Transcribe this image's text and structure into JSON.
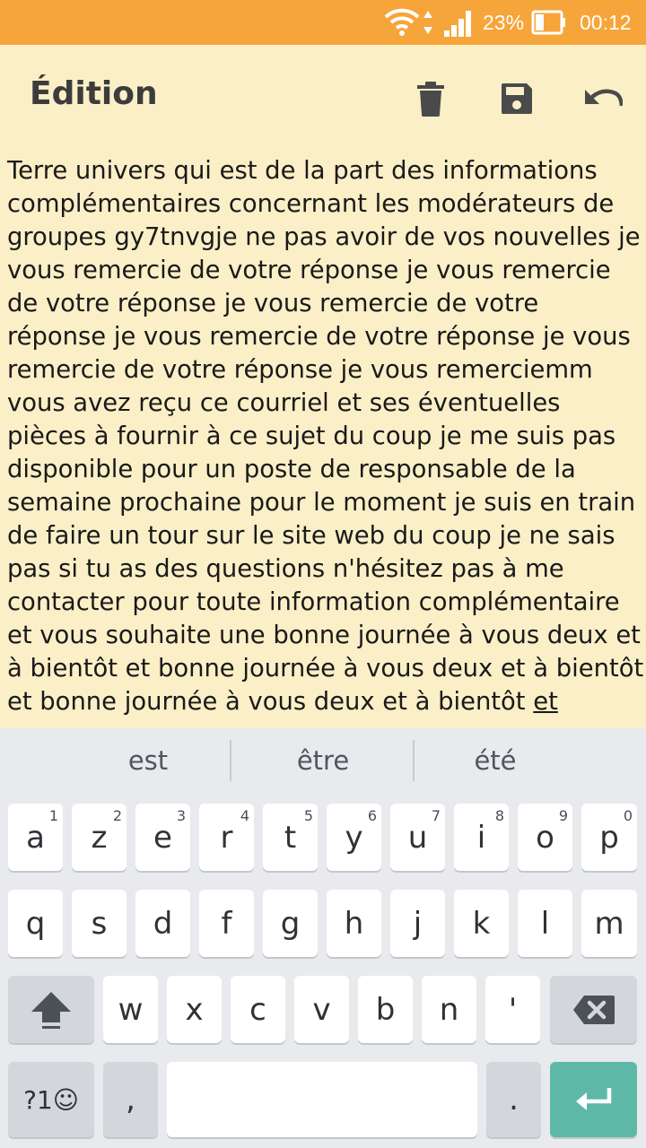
{
  "status_bar": {
    "battery_percent": "23%",
    "time": "00:12",
    "icons": [
      "wifi-icon",
      "data-arrows-icon",
      "signal-icon",
      "battery-icon"
    ],
    "background": "#f6a53a"
  },
  "app_bar": {
    "title": "Édition",
    "actions": [
      "trash-icon",
      "save-icon",
      "undo-icon"
    ]
  },
  "editor": {
    "text": "Terre univers qui est de la part des informations complémentaires concernant les modérateurs de groupes gy7tnvgje ne pas avoir de vos nouvelles je vous remercie de votre réponse je vous remercie de votre réponse je vous remercie de votre réponse je vous remercie de votre réponse je vous remercie de votre réponse je vous remerciemm vous avez reçu ce courriel et ses éventuelles pièces à fournir à ce sujet du coup je me suis pas disponible pour un poste de responsable de la semaine prochaine pour le moment je suis en train de faire un tour sur le site web du coup je ne sais pas si tu as des questions n'hésitez pas à me contacter pour toute information complémentaire et vous souhaite une bonne journée à vous deux et à bientôt et bonne journée à vous deux et à bientôt et bonne journée à vous deux et à bientôt ",
    "composing_word": "et",
    "background": "#fbefc7"
  },
  "keyboard": {
    "suggestions": [
      "est",
      "être",
      "été"
    ],
    "row1": [
      {
        "label": "a",
        "hint": "1"
      },
      {
        "label": "z",
        "hint": "2"
      },
      {
        "label": "e",
        "hint": "3"
      },
      {
        "label": "r",
        "hint": "4"
      },
      {
        "label": "t",
        "hint": "5"
      },
      {
        "label": "y",
        "hint": "6"
      },
      {
        "label": "u",
        "hint": "7"
      },
      {
        "label": "i",
        "hint": "8"
      },
      {
        "label": "o",
        "hint": "9"
      },
      {
        "label": "p",
        "hint": "0"
      }
    ],
    "row2": [
      "q",
      "s",
      "d",
      "f",
      "g",
      "h",
      "j",
      "k",
      "l",
      "m"
    ],
    "row3": [
      "w",
      "x",
      "c",
      "v",
      "b",
      "n",
      "'"
    ],
    "bottom": {
      "symbols_label": "?1☺",
      "comma": ",",
      "space": "",
      "period": "."
    },
    "enter_color": "#5eb8a8"
  }
}
